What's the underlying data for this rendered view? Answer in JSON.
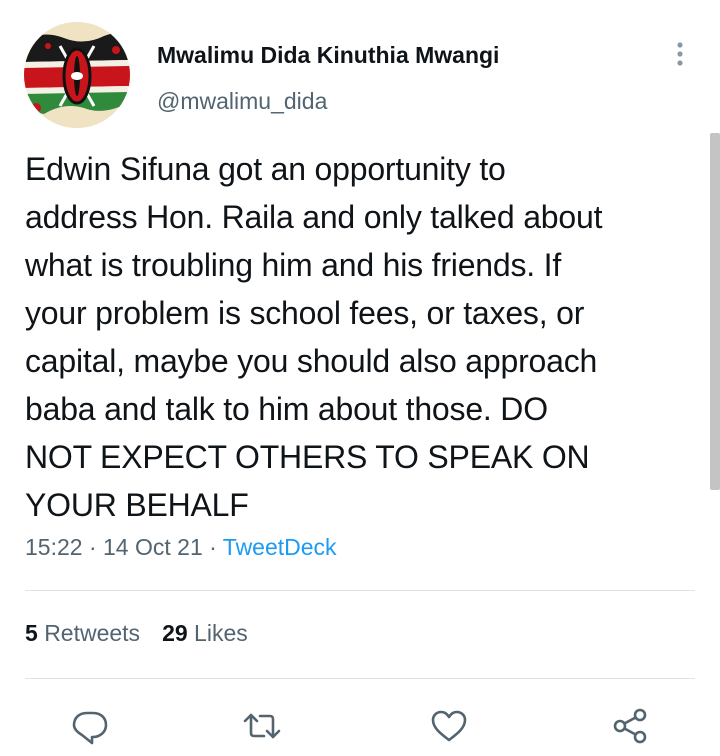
{
  "author": {
    "display_name": "Mwalimu Dida Kinuthia Mwangi",
    "handle": "@mwalimu_dida",
    "avatar": "kenyan-flag-avatar"
  },
  "tweet": {
    "text": "Edwin Sifuna got an opportunity to\naddress Hon. Raila and only talked about\nwhat is troubling him and his friends. If\nyour problem is school fees, or taxes, or\ncapital, maybe you should also approach\nbaba and talk to him about those. DO\nNOT EXPECT OTHERS TO SPEAK ON\nYOUR BEHALF",
    "time": "15:22",
    "separator": "·",
    "date": "14 Oct 21",
    "source": "TweetDeck"
  },
  "stats": {
    "retweets_count": "5",
    "retweets_label": "Retweets",
    "likes_count": "29",
    "likes_label": "Likes"
  },
  "actions": [
    "reply-icon",
    "retweet-icon",
    "like-icon",
    "share-icon"
  ],
  "colors": {
    "text": "#0f1419",
    "secondary": "#536471",
    "link": "#1d9bf0",
    "divider": "#dfe3e6"
  }
}
